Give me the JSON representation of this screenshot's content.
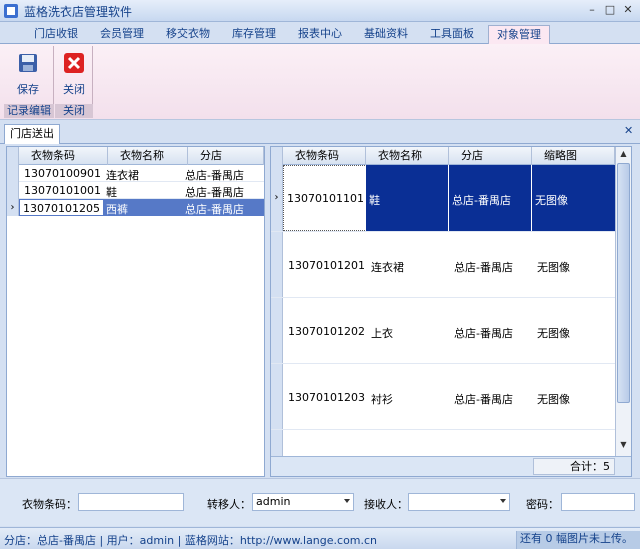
{
  "window": {
    "title": "蓝格洗衣店管理软件",
    "minimize": "–",
    "maximize": "□",
    "close": "✕"
  },
  "ribbon_tabs": [
    "门店收银",
    "会员管理",
    "移交衣物",
    "库存管理",
    "报表中心",
    "基础资料",
    "工具面板",
    "对象管理"
  ],
  "ribbon": {
    "groups": [
      {
        "label": "记录编辑",
        "buttons": [
          {
            "label": "保存",
            "icon": "save-icon"
          }
        ]
      },
      {
        "label": "关闭",
        "buttons": [
          {
            "label": "关闭",
            "icon": "close-icon"
          }
        ]
      }
    ]
  },
  "doc_tab": {
    "label": "门店送出",
    "close": "✕"
  },
  "left_grid": {
    "columns": [
      "衣物条码",
      "衣物名称",
      "分店"
    ],
    "rows": [
      {
        "barcode": "13070100901",
        "name": "连衣裙",
        "branch": "总店-番禺店"
      },
      {
        "barcode": "13070101001",
        "name": "鞋",
        "branch": "总店-番禺店"
      },
      {
        "barcode": "13070101205",
        "name": "西裤",
        "branch": "总店-番禺店",
        "selected": true
      }
    ]
  },
  "right_grid": {
    "columns": [
      "衣物条码",
      "衣物名称",
      "分店",
      "缩略图"
    ],
    "rows": [
      {
        "barcode": "13070101101",
        "name": "鞋",
        "branch": "总店-番禺店",
        "thumb": "无图像",
        "selected": true
      },
      {
        "barcode": "13070101201",
        "name": "连衣裙",
        "branch": "总店-番禺店",
        "thumb": "无图像"
      },
      {
        "barcode": "13070101202",
        "name": "上衣",
        "branch": "总店-番禺店",
        "thumb": "无图像"
      },
      {
        "barcode": "13070101203",
        "name": "衬衫",
        "branch": "总店-番禺店",
        "thumb": "无图像"
      }
    ],
    "footer_total": "合计：5"
  },
  "form": {
    "barcode_label": "衣物条码：",
    "barcode_value": "",
    "transfer_label": "转移人：",
    "transfer_value": "admin",
    "receiver_label": "接收人：",
    "receiver_value": "",
    "password_label": "密码：",
    "password_value": ""
  },
  "status": {
    "left": "分店：总店-番禺店  |  用户：admin  |  蓝格网站：http://www.lange.com.cn",
    "right": "还有 0 幅图片未上传。"
  },
  "colors": {
    "accent": "#15428b",
    "selected_row": "#0a2f95",
    "left_selected_row": "#5679c7"
  }
}
